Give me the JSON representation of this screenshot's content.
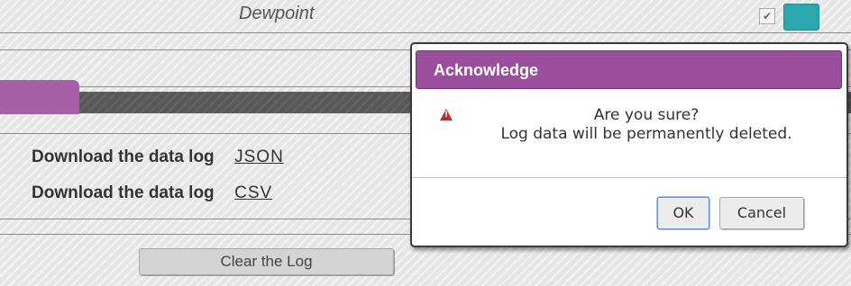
{
  "sensor_row": {
    "label": "Dewpoint",
    "checked_mark": "✔",
    "swatch_color": "#2aa7ae"
  },
  "log": {
    "rows": [
      {
        "label": "Download the data log",
        "link": "JSON"
      },
      {
        "label": "Download the data log",
        "link": "CSV"
      }
    ],
    "clear_button": "Clear the Log"
  },
  "dialog": {
    "title": "Acknowledge",
    "icon": "warning-icon",
    "message_line1": "Are you sure?",
    "message_line2": "Log data will be permanently deleted.",
    "ok_label": "OK",
    "cancel_label": "Cancel",
    "title_color": "#9a4f9d"
  },
  "accent_color": "#a45fa6"
}
